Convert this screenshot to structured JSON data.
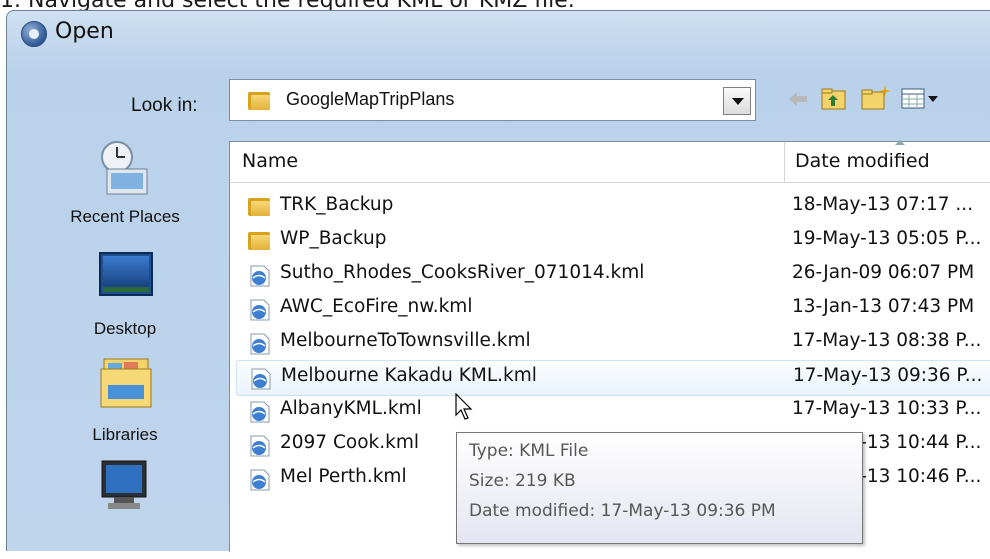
{
  "caption": "1. Navigate and select the required KML or KMZ file.",
  "dialog": {
    "title": "Open",
    "look_in_label": "Look in:",
    "look_in_value": "GoogleMapTripPlans"
  },
  "places": [
    {
      "label": "Recent Places",
      "icon": "recent-places-icon"
    },
    {
      "label": "Desktop",
      "icon": "desktop-icon"
    },
    {
      "label": "Libraries",
      "icon": "libraries-icon"
    },
    {
      "label": "Computer",
      "icon": "computer-icon"
    }
  ],
  "columns": {
    "name": "Name",
    "date": "Date modified"
  },
  "files": [
    {
      "name": "TRK_Backup",
      "date": "18-May-13 07:17 ...",
      "type": "folder"
    },
    {
      "name": "WP_Backup",
      "date": "19-May-13 05:05 P...",
      "type": "folder"
    },
    {
      "name": "Sutho_Rhodes_CooksRiver_071014.kml",
      "date": "26-Jan-09 06:07 PM",
      "type": "kml"
    },
    {
      "name": "AWC_EcoFire_nw.kml",
      "date": "13-Jan-13 07:43 PM",
      "type": "kml"
    },
    {
      "name": "MelbourneToTownsville.kml",
      "date": "17-May-13 08:38 P...",
      "type": "kml"
    },
    {
      "name": "Melbourne Kakadu KML.kml",
      "date": "17-May-13 09:36 P...",
      "type": "kml"
    },
    {
      "name": "AlbanyKML.kml",
      "date": "17-May-13 10:33 P...",
      "type": "kml"
    },
    {
      "name": "2097 Cook.kml",
      "date": "17-May-13 10:44 P...",
      "type": "kml"
    },
    {
      "name": "Mel Perth.kml",
      "date": "17-May-13 10:46 P...",
      "type": "kml"
    }
  ],
  "tooltip": {
    "type": "Type: KML File",
    "size": "Size: 219 KB",
    "modified": "Date modified: 17-May-13 09:36 PM"
  },
  "colors": {
    "dialog_bg": "#c4d8ee",
    "hover_row": "#eaf3fc",
    "folder": "#e3b13a"
  }
}
